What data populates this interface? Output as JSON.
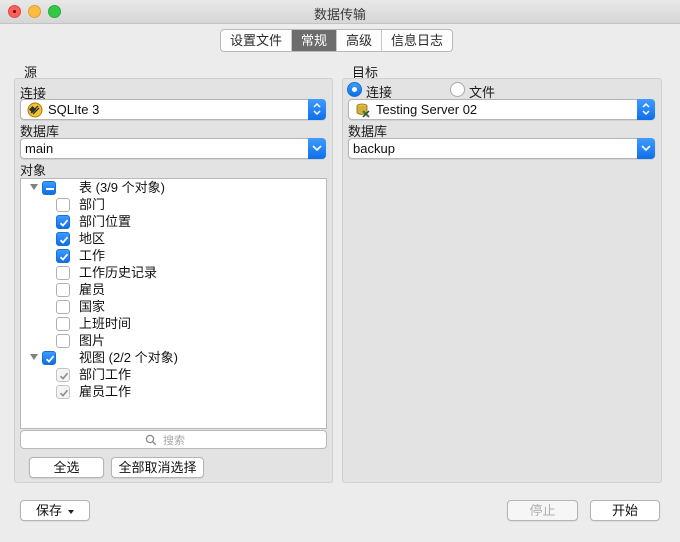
{
  "window": {
    "title": "数据传输"
  },
  "tabs": [
    {
      "label": "设置文件",
      "active": false
    },
    {
      "label": "常规",
      "active": true
    },
    {
      "label": "高级",
      "active": false
    },
    {
      "label": "信息日志",
      "active": false
    }
  ],
  "source": {
    "section_label": "源",
    "connection_label": "连接",
    "connection_value": "SQLIte 3",
    "connection_icon": "sqlite-icon",
    "database_label": "数据库",
    "database_value": "main",
    "objects_label": "对象",
    "tree": {
      "tables_group": {
        "label": "表 (3/9 个对象)",
        "state": "mixed",
        "expanded": true
      },
      "tables": [
        {
          "label": "部门",
          "checked": false
        },
        {
          "label": "部门位置",
          "checked": true
        },
        {
          "label": "地区",
          "checked": true
        },
        {
          "label": "工作",
          "checked": true
        },
        {
          "label": "工作历史记录",
          "checked": false
        },
        {
          "label": "雇员",
          "checked": false
        },
        {
          "label": "国家",
          "checked": false
        },
        {
          "label": "上班时间",
          "checked": false
        },
        {
          "label": "图片",
          "checked": false
        }
      ],
      "views_group": {
        "label": "视图 (2/2 个对象)",
        "state": "checked",
        "expanded": true
      },
      "views": [
        {
          "label": "部门工作",
          "checked": true
        },
        {
          "label": "雇员工作",
          "checked": true
        }
      ]
    },
    "search_placeholder": "搜索",
    "select_all_label": "全选",
    "deselect_all_label": "全部取消选择"
  },
  "target": {
    "section_label": "目标",
    "mode_connection_label": "连接",
    "mode_file_label": "文件",
    "selected_mode": "connection",
    "connection_value": "Testing Server 02",
    "connection_icon": "server-connection-icon",
    "database_label": "数据库",
    "database_value": "backup"
  },
  "footer": {
    "save_label": "保存",
    "stop_label": "停止",
    "start_label": "开始"
  },
  "colors": {
    "accent": "#0e6fe6",
    "active_tab": "#6d6d6d",
    "panel_bg": "#e3e3e3"
  }
}
